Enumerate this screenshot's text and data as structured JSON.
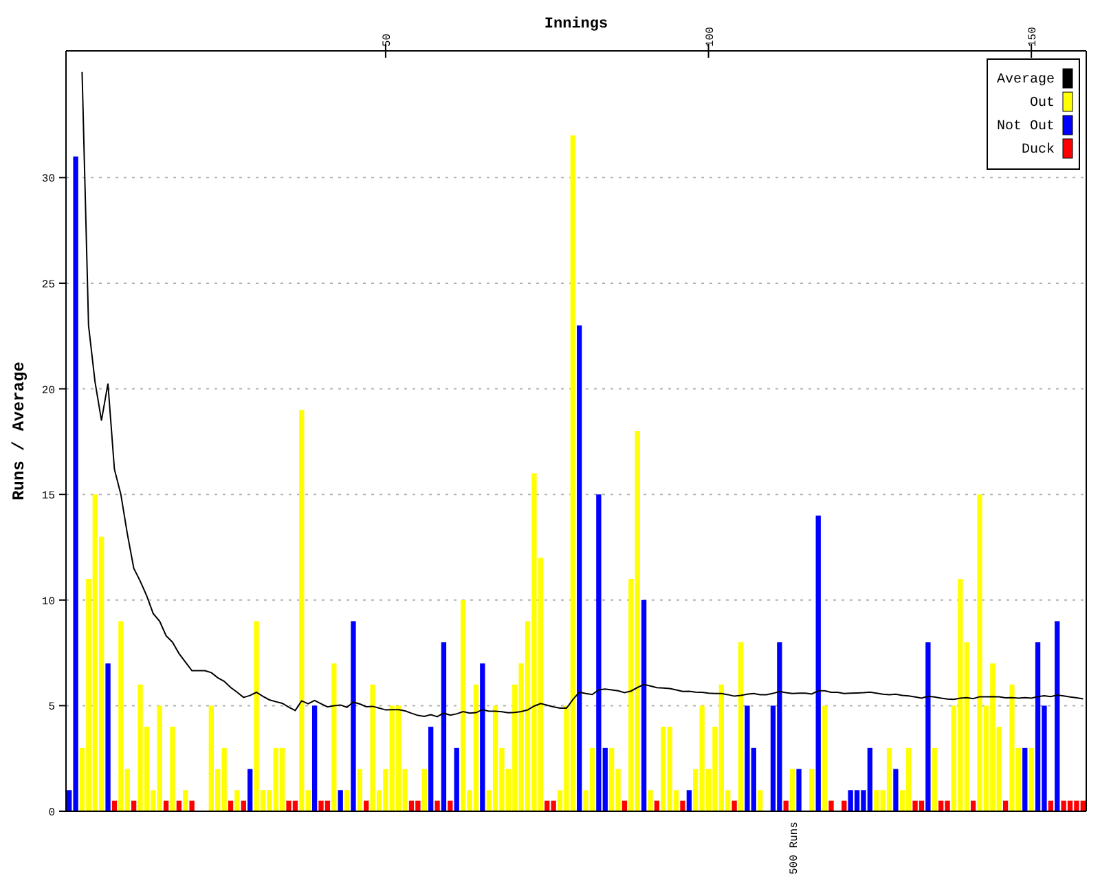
{
  "chart_data": {
    "type": "bar",
    "title": "Innings",
    "ylabel": "Runs / Average",
    "xlim": [
      0,
      158
    ],
    "ylim": [
      0,
      36
    ],
    "xticks": [
      50,
      100,
      150
    ],
    "yticks": [
      0,
      5,
      10,
      15,
      20,
      25,
      30
    ],
    "grid": true,
    "legend": true,
    "x": [
      1,
      2,
      3,
      4,
      5,
      6,
      7,
      8,
      9,
      10,
      11,
      12,
      13,
      14,
      15,
      16,
      17,
      18,
      19,
      20,
      21,
      22,
      23,
      24,
      25,
      26,
      27,
      28,
      29,
      30,
      31,
      32,
      33,
      34,
      35,
      36,
      37,
      38,
      39,
      40,
      41,
      42,
      43,
      44,
      45,
      46,
      47,
      48,
      49,
      50,
      51,
      52,
      53,
      54,
      55,
      56,
      57,
      58,
      59,
      60,
      61,
      62,
      63,
      64,
      65,
      66,
      67,
      68,
      69,
      70,
      71,
      72,
      73,
      74,
      75,
      76,
      77,
      78,
      79,
      80,
      81,
      82,
      83,
      84,
      85,
      86,
      87,
      88,
      89,
      90,
      91,
      92,
      93,
      94,
      95,
      96,
      97,
      98,
      99,
      100,
      101,
      102,
      103,
      104,
      105,
      106,
      107,
      108,
      109,
      110,
      111,
      112,
      113,
      114,
      115,
      116,
      117,
      118,
      119,
      120,
      121,
      122,
      123,
      124,
      125,
      126,
      127,
      128,
      129,
      130,
      131,
      132,
      133,
      134,
      135,
      136,
      137,
      138,
      139,
      140,
      141,
      142,
      143,
      144,
      145,
      146,
      147,
      148,
      149,
      150,
      151,
      152,
      153,
      154,
      155,
      156,
      157,
      158
    ],
    "series": [
      {
        "name": "Average",
        "color": "#000000",
        "type": "line",
        "values": [
          null,
          null,
          35,
          23,
          20.33,
          18.5,
          20.25,
          16.2,
          15,
          13.14,
          11.5,
          10.89,
          10.2,
          9.36,
          9,
          8.31,
          8,
          7.47,
          7.06,
          6.65,
          6.65,
          6.65,
          6.56,
          6.32,
          6.15,
          5.86,
          5.64,
          5.39,
          5.48,
          5.63,
          5.44,
          5.27,
          5.19,
          5.11,
          4.93,
          4.77,
          5.23,
          5.09,
          5.25,
          5.09,
          4.94,
          5,
          5.03,
          4.92,
          5.17,
          5.08,
          4.95,
          4.97,
          4.88,
          4.8,
          4.81,
          4.81,
          4.75,
          4.64,
          4.54,
          4.49,
          4.57,
          4.48,
          4.65,
          4.55,
          4.61,
          4.72,
          4.65,
          4.67,
          4.81,
          4.74,
          4.74,
          4.71,
          4.66,
          4.68,
          4.72,
          4.8,
          4.98,
          5.1,
          5.02,
          4.94,
          4.88,
          4.88,
          5.29,
          5.64,
          5.57,
          5.53,
          5.75,
          5.79,
          5.75,
          5.7,
          5.62,
          5.69,
          5.86,
          6,
          5.93,
          5.85,
          5.83,
          5.81,
          5.74,
          5.67,
          5.68,
          5.64,
          5.63,
          5.59,
          5.57,
          5.57,
          5.52,
          5.45,
          5.48,
          5.54,
          5.57,
          5.52,
          5.52,
          5.58,
          5.67,
          5.61,
          5.57,
          5.59,
          5.59,
          5.55,
          5.7,
          5.7,
          5.63,
          5.63,
          5.57,
          5.59,
          5.6,
          5.61,
          5.64,
          5.59,
          5.54,
          5.52,
          5.54,
          5.49,
          5.46,
          5.41,
          5.36,
          5.44,
          5.41,
          5.36,
          5.31,
          5.3,
          5.36,
          5.38,
          5.33,
          5.42,
          5.42,
          5.43,
          5.42,
          5.37,
          5.38,
          5.36,
          5.38,
          5.36,
          5.43,
          5.47,
          5.43,
          5.5,
          5.46,
          5.41,
          5.37,
          5.32
        ]
      },
      {
        "name": "Out",
        "color": "#ffff00",
        "values": [
          null,
          null,
          3,
          11,
          15,
          13,
          null,
          null,
          9,
          2,
          null,
          6,
          4,
          1,
          5,
          null,
          4,
          null,
          1,
          null,
          null,
          null,
          5,
          2,
          3,
          null,
          1,
          null,
          null,
          9,
          1,
          1,
          3,
          3,
          null,
          null,
          19,
          1,
          null,
          null,
          null,
          7,
          null,
          1,
          null,
          2,
          null,
          6,
          1,
          2,
          5,
          5,
          2,
          null,
          null,
          2,
          null,
          null,
          null,
          null,
          null,
          10,
          1,
          6,
          null,
          1,
          5,
          3,
          2,
          6,
          7,
          9,
          16,
          12,
          null,
          null,
          1,
          5,
          32,
          null,
          1,
          3,
          null,
          null,
          3,
          2,
          null,
          11,
          18,
          null,
          1,
          null,
          4,
          4,
          1,
          null,
          null,
          2,
          5,
          2,
          4,
          6,
          1,
          null,
          8,
          null,
          null,
          1,
          null,
          null,
          null,
          null,
          2,
          null,
          null,
          2,
          null,
          5,
          null,
          null,
          null,
          null,
          null,
          null,
          null,
          1,
          1,
          3,
          null,
          1,
          3,
          null,
          null,
          null,
          3,
          null,
          null,
          5,
          11,
          8,
          null,
          15,
          5,
          7,
          4,
          null,
          6,
          3,
          null,
          3,
          null,
          null,
          null,
          null,
          null,
          null,
          null,
          null
        ]
      },
      {
        "name": "Not Out",
        "color": "#0000ff",
        "values": [
          1,
          31,
          null,
          null,
          null,
          null,
          7,
          null,
          null,
          null,
          null,
          null,
          null,
          null,
          null,
          null,
          null,
          null,
          null,
          null,
          null,
          null,
          null,
          null,
          null,
          null,
          null,
          null,
          2,
          null,
          null,
          null,
          null,
          null,
          null,
          null,
          null,
          null,
          5,
          null,
          null,
          null,
          1,
          null,
          9,
          null,
          null,
          null,
          null,
          null,
          null,
          null,
          null,
          null,
          null,
          null,
          4,
          null,
          8,
          null,
          3,
          null,
          null,
          null,
          7,
          null,
          null,
          null,
          null,
          null,
          null,
          null,
          null,
          null,
          null,
          null,
          null,
          null,
          null,
          23,
          null,
          null,
          15,
          3,
          null,
          null,
          null,
          null,
          null,
          10,
          null,
          null,
          null,
          null,
          null,
          null,
          1,
          null,
          null,
          null,
          null,
          null,
          null,
          null,
          null,
          5,
          3,
          null,
          null,
          5,
          8,
          null,
          null,
          2,
          null,
          null,
          14,
          null,
          null,
          null,
          null,
          1,
          1,
          1,
          3,
          null,
          null,
          null,
          2,
          null,
          null,
          null,
          null,
          8,
          null,
          null,
          null,
          null,
          null,
          null,
          null,
          null,
          null,
          null,
          null,
          null,
          null,
          null,
          3,
          null,
          8,
          5,
          null,
          9,
          null,
          null,
          null,
          null
        ]
      },
      {
        "name": "Duck",
        "color": "#ff0000",
        "values": [
          null,
          null,
          null,
          null,
          null,
          null,
          null,
          0,
          null,
          null,
          0,
          null,
          null,
          null,
          null,
          0,
          null,
          0,
          null,
          0,
          null,
          null,
          null,
          null,
          null,
          0,
          null,
          0,
          null,
          null,
          null,
          null,
          null,
          null,
          0,
          0,
          null,
          null,
          null,
          0,
          0,
          null,
          null,
          null,
          null,
          null,
          0,
          null,
          null,
          null,
          null,
          null,
          null,
          0,
          0,
          null,
          null,
          0,
          null,
          0,
          null,
          null,
          null,
          null,
          null,
          null,
          null,
          null,
          null,
          null,
          null,
          null,
          null,
          null,
          0,
          0,
          null,
          null,
          null,
          null,
          null,
          null,
          null,
          null,
          null,
          null,
          0,
          null,
          null,
          null,
          null,
          0,
          null,
          null,
          null,
          0,
          null,
          null,
          null,
          null,
          null,
          null,
          null,
          0,
          null,
          null,
          null,
          null,
          null,
          null,
          null,
          0,
          null,
          null,
          null,
          null,
          null,
          null,
          0,
          null,
          0,
          null,
          null,
          null,
          null,
          null,
          null,
          null,
          null,
          null,
          null,
          0,
          0,
          null,
          null,
          0,
          0,
          null,
          null,
          null,
          0,
          null,
          null,
          null,
          null,
          0,
          null,
          null,
          null,
          null,
          null,
          null,
          0,
          null,
          0,
          0,
          0,
          0
        ]
      }
    ],
    "annotations": [
      "500 Runs"
    ]
  }
}
